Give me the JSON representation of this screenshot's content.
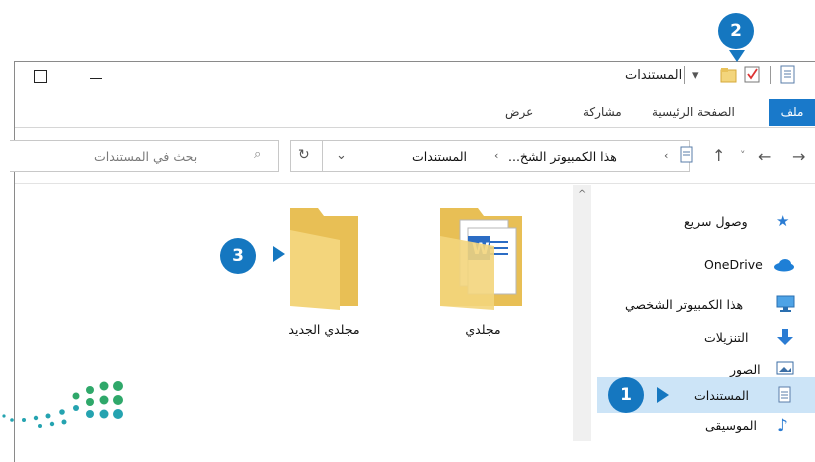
{
  "window": {
    "title": "المستندات"
  },
  "ribbon": {
    "tabs": [
      "ملف",
      "الصفحة الرئيسية",
      "مشاركة",
      "عرض"
    ]
  },
  "address_bar": {
    "path_this_pc": "هذا الكمبيوتر الشخ...",
    "path_documents": "المستندات",
    "search_placeholder": "بحث في المستندات"
  },
  "nav_pane": {
    "items": [
      {
        "label": "وصول سريع",
        "icon": "star-icon"
      },
      {
        "label": "OneDrive",
        "icon": "cloud-icon"
      },
      {
        "label": "هذا الكمبيوتر الشخصي",
        "icon": "computer-icon"
      },
      {
        "label": "التنزيلات",
        "icon": "download-arrow-icon"
      },
      {
        "label": "الصور",
        "icon": "pictures-icon"
      },
      {
        "label": "المستندات",
        "icon": "documents-icon",
        "selected": true
      },
      {
        "label": "الموسيقى",
        "icon": "music-note-icon"
      }
    ]
  },
  "files": [
    {
      "name": "مجلدي",
      "type": "folder-with-documents"
    },
    {
      "name": "مجلدي الجديد",
      "type": "empty-folder"
    }
  ],
  "callouts": [
    "1",
    "2",
    "3"
  ],
  "colors": {
    "accent": "#1979ca",
    "badge": "#1577c0",
    "selection": "#cce4f7",
    "folder": "#f3d57c",
    "logo_green": "#2fa86a",
    "logo_teal": "#25a3b0"
  }
}
